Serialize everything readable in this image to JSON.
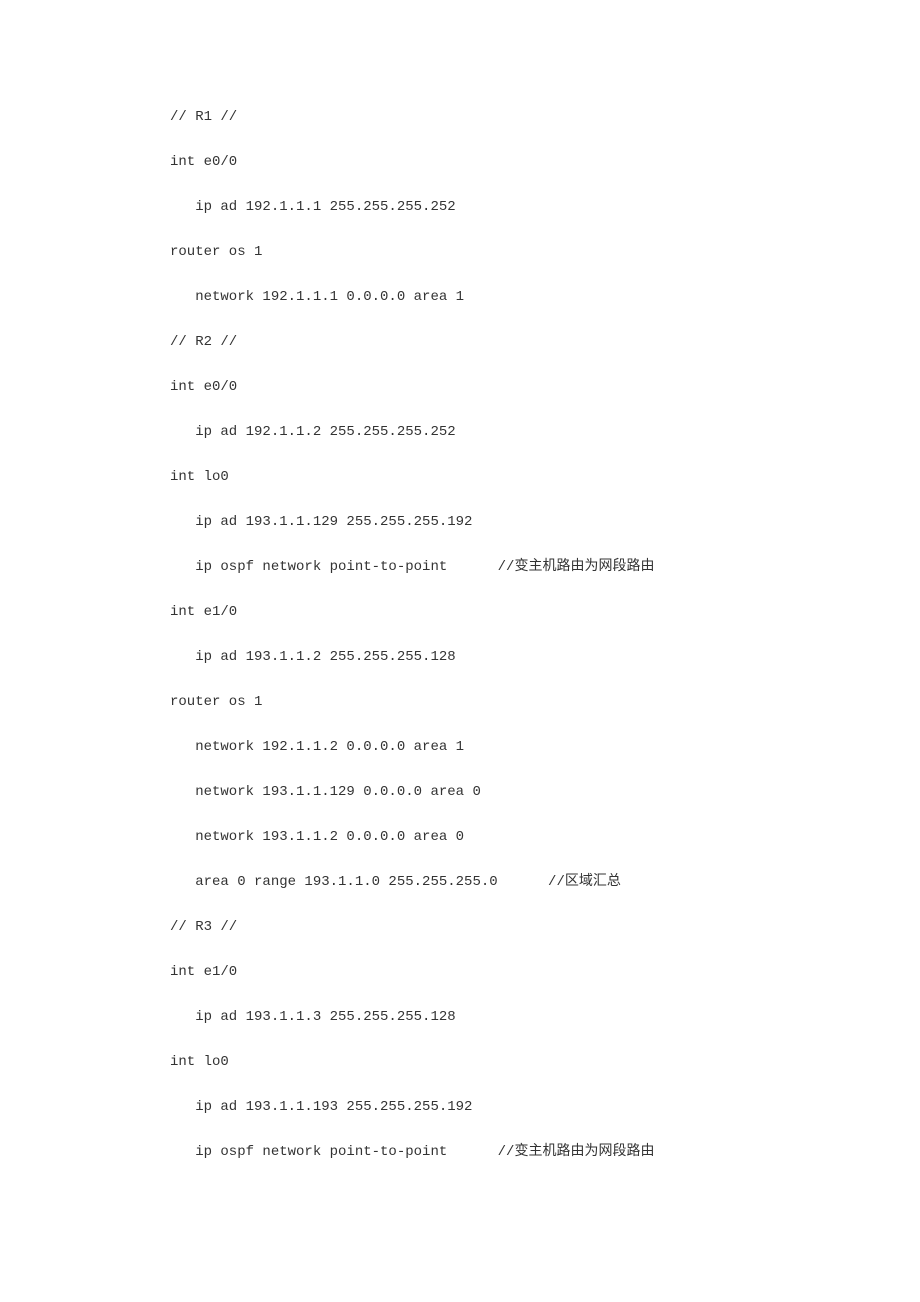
{
  "lines": [
    "// R1 //",
    "int e0/0",
    "   ip ad 192.1.1.1 255.255.255.252",
    "router os 1",
    "   network 192.1.1.1 0.0.0.0 area 1",
    "// R2 //",
    "int e0/0",
    "   ip ad 192.1.1.2 255.255.255.252",
    "int lo0",
    "   ip ad 193.1.1.129 255.255.255.192",
    "   ip ospf network point-to-point      //变主机路由为网段路由",
    "int e1/0",
    "   ip ad 193.1.1.2 255.255.255.128",
    "router os 1",
    "   network 192.1.1.2 0.0.0.0 area 1",
    "   network 193.1.1.129 0.0.0.0 area 0",
    "   network 193.1.1.2 0.0.0.0 area 0",
    "   area 0 range 193.1.1.0 255.255.255.0      //区域汇总",
    "// R3 //",
    "int e1/0",
    "   ip ad 193.1.1.3 255.255.255.128",
    "int lo0",
    "   ip ad 193.1.1.193 255.255.255.192",
    "   ip ospf network point-to-point      //变主机路由为网段路由"
  ]
}
